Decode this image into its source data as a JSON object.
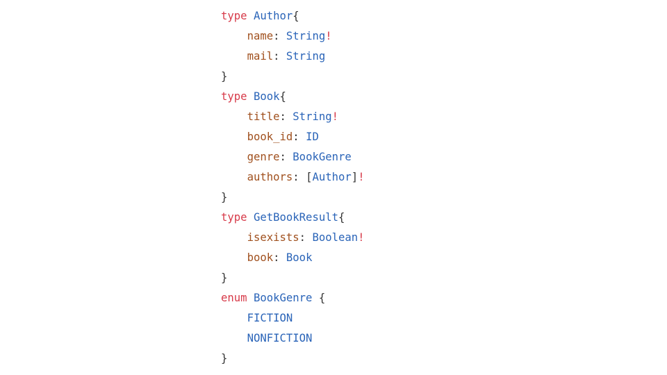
{
  "colors": {
    "keyword": "#d73a49",
    "type": "#2a64b8",
    "field": "#a0501e",
    "punctuation": "#333333",
    "required": "#d73a49"
  },
  "lines": [
    {
      "indent": 0,
      "tokens": [
        {
          "t": "type",
          "k": "kw"
        },
        {
          "t": " ",
          "k": "pu"
        },
        {
          "t": "Author",
          "k": "ty"
        },
        {
          "t": "{",
          "k": "pu"
        }
      ]
    },
    {
      "indent": 1,
      "tokens": [
        {
          "t": "name",
          "k": "fd"
        },
        {
          "t": ": ",
          "k": "pu"
        },
        {
          "t": "String",
          "k": "ty"
        },
        {
          "t": "!",
          "k": "bang"
        }
      ]
    },
    {
      "indent": 1,
      "tokens": [
        {
          "t": "mail",
          "k": "fd"
        },
        {
          "t": ": ",
          "k": "pu"
        },
        {
          "t": "String",
          "k": "ty"
        }
      ]
    },
    {
      "indent": 0,
      "tokens": [
        {
          "t": "}",
          "k": "pu"
        }
      ]
    },
    {
      "indent": 0,
      "tokens": [
        {
          "t": "type",
          "k": "kw"
        },
        {
          "t": " ",
          "k": "pu"
        },
        {
          "t": "Book",
          "k": "ty"
        },
        {
          "t": "{",
          "k": "pu"
        }
      ]
    },
    {
      "indent": 1,
      "tokens": [
        {
          "t": "title",
          "k": "fd"
        },
        {
          "t": ": ",
          "k": "pu"
        },
        {
          "t": "String",
          "k": "ty"
        },
        {
          "t": "!",
          "k": "bang"
        }
      ]
    },
    {
      "indent": 1,
      "tokens": [
        {
          "t": "book_id",
          "k": "fd"
        },
        {
          "t": ": ",
          "k": "pu"
        },
        {
          "t": "ID",
          "k": "ty"
        }
      ]
    },
    {
      "indent": 1,
      "tokens": [
        {
          "t": "genre",
          "k": "fd"
        },
        {
          "t": ": ",
          "k": "pu"
        },
        {
          "t": "BookGenre",
          "k": "ty"
        }
      ]
    },
    {
      "indent": 1,
      "tokens": [
        {
          "t": "authors",
          "k": "fd"
        },
        {
          "t": ": ",
          "k": "pu"
        },
        {
          "t": "[",
          "k": "pu"
        },
        {
          "t": "Author",
          "k": "ty"
        },
        {
          "t": "]",
          "k": "pu"
        },
        {
          "t": "!",
          "k": "bang"
        }
      ]
    },
    {
      "indent": 0,
      "tokens": [
        {
          "t": "}",
          "k": "pu"
        }
      ]
    },
    {
      "indent": 0,
      "tokens": [
        {
          "t": "type",
          "k": "kw"
        },
        {
          "t": " ",
          "k": "pu"
        },
        {
          "t": "GetBookResult",
          "k": "ty"
        },
        {
          "t": "{",
          "k": "pu"
        }
      ]
    },
    {
      "indent": 1,
      "tokens": [
        {
          "t": "isexists",
          "k": "fd"
        },
        {
          "t": ": ",
          "k": "pu"
        },
        {
          "t": "Boolean",
          "k": "ty"
        },
        {
          "t": "!",
          "k": "bang"
        }
      ]
    },
    {
      "indent": 1,
      "tokens": [
        {
          "t": "book",
          "k": "fd"
        },
        {
          "t": ": ",
          "k": "pu"
        },
        {
          "t": "Book",
          "k": "ty"
        }
      ]
    },
    {
      "indent": 0,
      "tokens": [
        {
          "t": "}",
          "k": "pu"
        }
      ]
    },
    {
      "indent": 0,
      "tokens": [
        {
          "t": "enum",
          "k": "kw"
        },
        {
          "t": " ",
          "k": "pu"
        },
        {
          "t": "BookGenre",
          "k": "ty"
        },
        {
          "t": " {",
          "k": "pu"
        }
      ]
    },
    {
      "indent": 1,
      "tokens": [
        {
          "t": "FICTION",
          "k": "ty"
        }
      ]
    },
    {
      "indent": 1,
      "tokens": [
        {
          "t": "NONFICTION",
          "k": "ty"
        }
      ]
    },
    {
      "indent": 0,
      "tokens": [
        {
          "t": "}",
          "k": "pu"
        }
      ]
    }
  ]
}
